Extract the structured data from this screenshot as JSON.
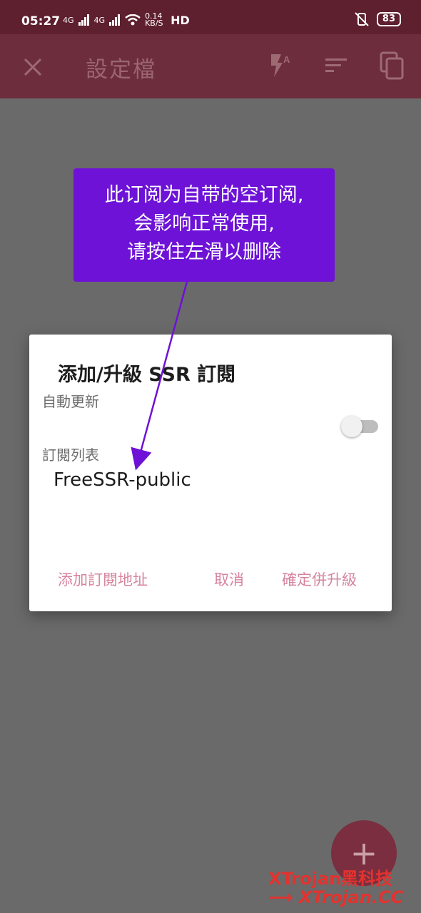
{
  "status_bar": {
    "time": "05:27",
    "net1": "4G",
    "net2": "4G",
    "speed": "0.14 KB/S",
    "hd": "HD",
    "battery": "83"
  },
  "app_bar": {
    "title": "設定檔",
    "icons": [
      "close-icon",
      "flash-auto-icon",
      "sort-icon",
      "copy-icon"
    ]
  },
  "tooltip": {
    "lines": [
      "此订阅为自带的空订阅,",
      "会影响正常使用,",
      "请按住左滑以删除"
    ]
  },
  "dialog": {
    "title": "添加/升級 SSR 訂閱",
    "auto_update_label": "自動更新",
    "list_label": "訂閱列表",
    "list_item": "FreeSSR-public",
    "auto_update_on": false,
    "buttons": {
      "add": "添加訂閱地址",
      "cancel": "取消",
      "confirm": "確定併升級"
    }
  },
  "fab": {
    "label": "+"
  },
  "watermark": {
    "line1": "XTrojan黑科技",
    "line2": "XTrojan.CC"
  },
  "colors": {
    "status_bar": "#5e1f2e",
    "app_bar": "#6d2d3d",
    "tooltip": "#6d12d6",
    "dialog_button": "#d6849e",
    "watermark": "#e2332f"
  }
}
